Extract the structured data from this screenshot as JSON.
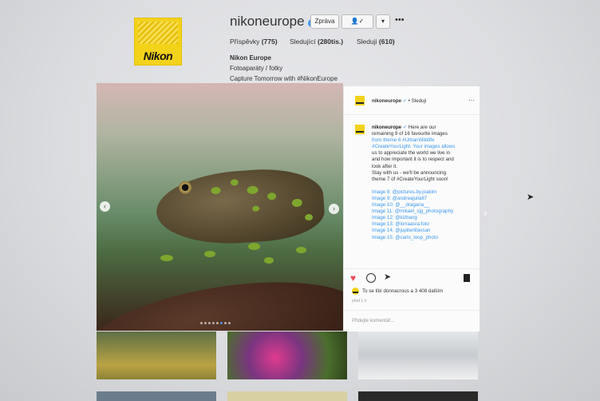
{
  "profile": {
    "logo_text": "Nikon",
    "username": "nikoneurope",
    "message_button": "Zpráva",
    "stats": {
      "posts_label": "Příspěvky",
      "posts_value": "(775)",
      "followers_label": "Sledující",
      "followers_value": "(280tis.)",
      "following_label": "Sleduji",
      "following_value": "(610)"
    },
    "bio": {
      "name": "Nikon Europe",
      "category": "Fotoaparáty / fotky",
      "tagline": "Capture Tomorrow with #NikonEurope"
    }
  },
  "post": {
    "username": "nikoneurope",
    "follow_label": "• Sleduji",
    "caption_username": "nikoneurope",
    "caption_lines": [
      "Here are our",
      "remaining 9 of 16 favourite images",
      "from theme 6 #UrbanWildlife",
      "#CreateYourLight. Your images allows",
      "us to appreciate the world we live in",
      "and how important it is to respect and",
      "look after it.",
      "Stay with us - we'll be announcing",
      "theme 7 of #CreateYourLight soon!"
    ],
    "credits": [
      "Image 8: @pictures.by.joakim",
      "Image 9: @andreajuila87",
      "Image 10: @__dragana__",
      "Image 11: @mikael_sjg_photography",
      "Image 12: @kizbang",
      "Image 13: @lorraasra.foto",
      "Image 14: @jupiterlitavsan",
      "Image 15: @carlo_loop_photo"
    ],
    "likes_text": "To se líbí donnacrous a 3 408 dalším",
    "time": "před 1 h",
    "comment_placeholder": "Přidejte komentář..."
  },
  "icons": {
    "like": "heart-icon",
    "comment": "comment-icon",
    "share": "share-icon",
    "save": "bookmark-icon",
    "more": "more-icon"
  },
  "colors": {
    "accent": "#3897f0",
    "heart": "#ed4956",
    "logo_yellow": "#f3d21a"
  }
}
